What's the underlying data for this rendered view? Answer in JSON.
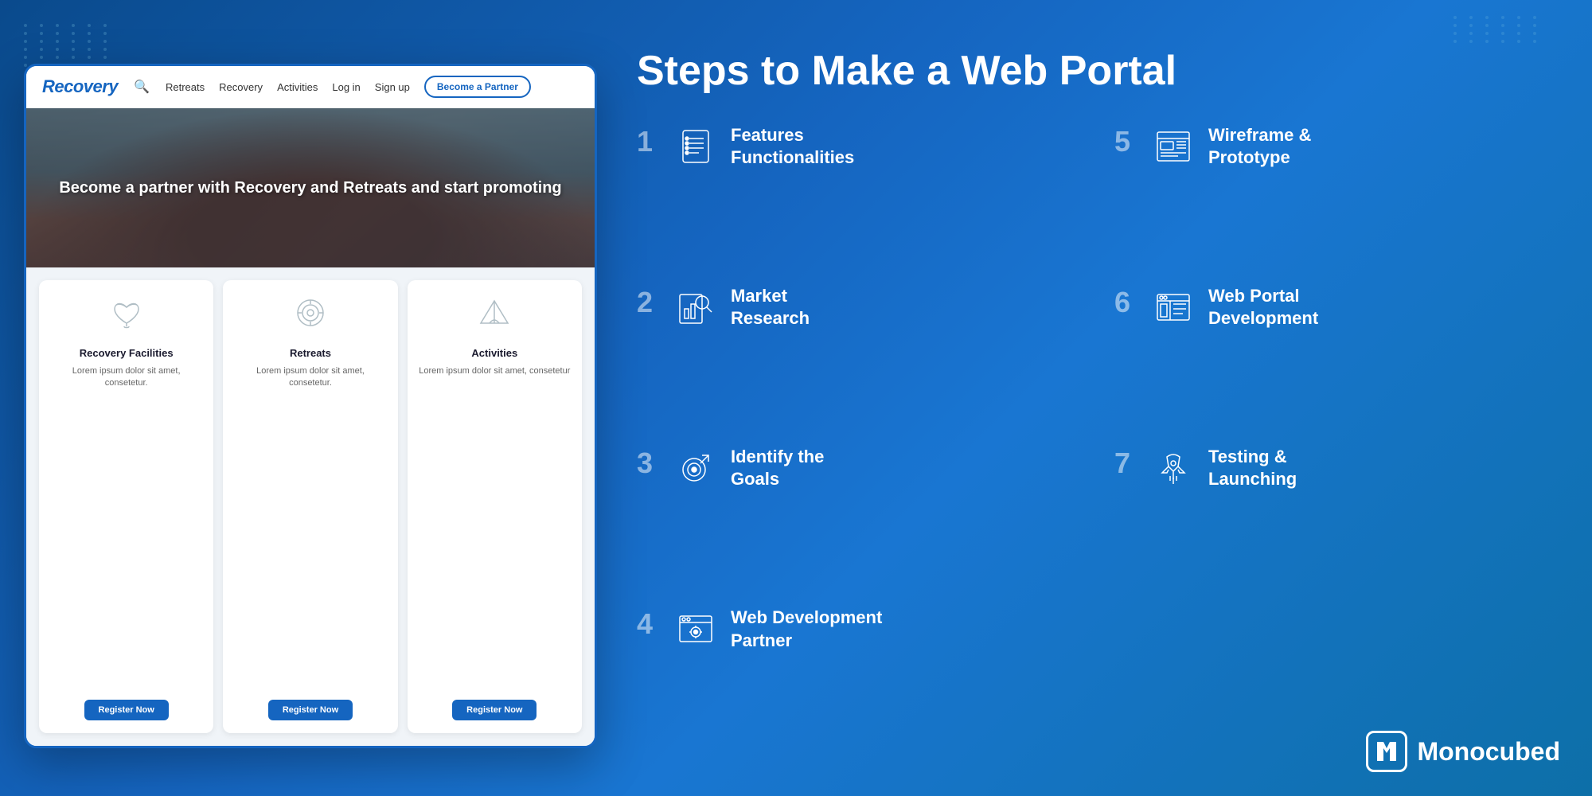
{
  "background": {
    "gradient_start": "#0a4a8c",
    "gradient_end": "#0d6fa8"
  },
  "nav": {
    "logo": "Recovery",
    "links": [
      "Retreats",
      "Recovery",
      "Activities",
      "Log in",
      "Sign up"
    ],
    "cta_button": "Become a Partner",
    "search_icon": "search"
  },
  "hero": {
    "text": "Become a partner with Recovery and Retreats and start promoting"
  },
  "cards": [
    {
      "title": "Recovery Facilities",
      "description": "Lorem ipsum dolor sit amet, consetetur.",
      "button_label": "Register Now",
      "icon": "lotus"
    },
    {
      "title": "Retreats",
      "description": "Lorem ipsum dolor sit amet, consetetur.",
      "button_label": "Register Now",
      "icon": "circle-ornament"
    },
    {
      "title": "Activities",
      "description": "Lorem ipsum dolor sit amet, consetetur",
      "button_label": "Register Now",
      "icon": "tent"
    }
  ],
  "right": {
    "title": "Steps to Make a Web Portal",
    "steps": [
      {
        "number": "1",
        "label": "Features\nFunctionalities",
        "icon": "checklist"
      },
      {
        "number": "2",
        "label": "Market\nResearch",
        "icon": "chart-search"
      },
      {
        "number": "3",
        "label": "Identify the\nGoals",
        "icon": "target"
      },
      {
        "number": "4",
        "label": "Web Development\nPartner",
        "icon": "browser-settings"
      },
      {
        "number": "5",
        "label": "Wireframe &\nPrototype",
        "icon": "wireframe"
      },
      {
        "number": "6",
        "label": "Web Portal\nDevelopment",
        "icon": "web-dev"
      },
      {
        "number": "7",
        "label": "Testing &\nLaunching",
        "icon": "rocket"
      }
    ]
  },
  "branding": {
    "name": "Monocubed",
    "logo_alt": "M logo"
  }
}
